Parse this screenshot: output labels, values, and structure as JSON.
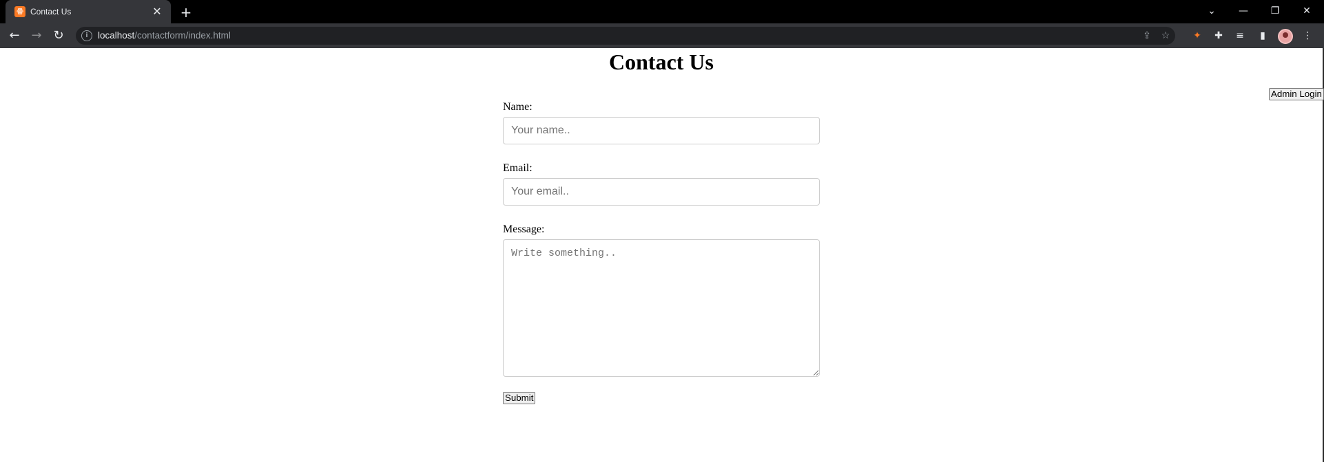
{
  "browser": {
    "tab": {
      "title": "Contact Us",
      "favicon": "xampp-favicon-icon",
      "close_glyph": "✕"
    },
    "new_tab_glyph": "+",
    "window_controls": {
      "dropdown": "⌄",
      "minimize": "—",
      "restore": "❐",
      "close": "✕"
    },
    "nav": {
      "back": "←",
      "forward": "→",
      "reload": "↻"
    },
    "address": {
      "host": "localhost",
      "path": "/contactform/index.html"
    },
    "omnibox_icons": {
      "share": "⇪",
      "bookmark": "☆"
    },
    "extension_icons": {
      "extension": "✦",
      "puzzle": "✚",
      "media": "≡",
      "sidepanel": "▮",
      "menu": "⋮"
    },
    "colors": {
      "tab_active": "#35363a",
      "tabbar": "#000000",
      "extension_accent": "#fb7a24"
    }
  },
  "page": {
    "title": "Contact Us",
    "admin_login_label": "Admin Login",
    "form": {
      "name_label": "Name:",
      "name_placeholder": "Your name..",
      "email_label": "Email:",
      "email_placeholder": "Your email..",
      "message_label": "Message:",
      "message_placeholder": "Write something..",
      "submit_label": "Submit"
    }
  }
}
